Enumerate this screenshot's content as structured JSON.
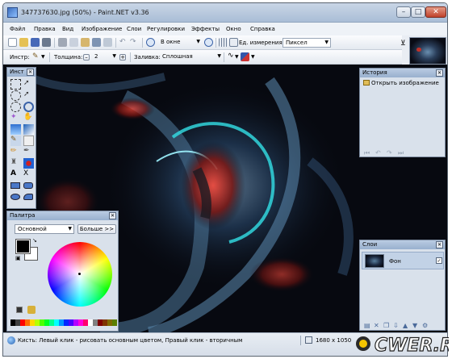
{
  "window": {
    "title": "347737630.jpg (50%) - Paint.NET v3.36"
  },
  "menu": [
    "Файл",
    "Правка",
    "Вид",
    "Изображение",
    "Слои",
    "Регулировки",
    "Эффекты",
    "Окно",
    "Справка"
  ],
  "toolbar1": {
    "zoom_value": "В окне",
    "units_label": "Ед. измерения:",
    "units_value": "Пиксел"
  },
  "toolbar2": {
    "tool_label": "Инстр:",
    "width_label": "Толщина:",
    "width_value": "2",
    "fill_label": "Заливка:",
    "fill_value": "Сплошная"
  },
  "tools_panel": {
    "title": "Инст"
  },
  "palette_panel": {
    "title": "Палитра",
    "palette_select": "Основной",
    "more_button": "Больше >>",
    "colors": [
      "#000000",
      "#404040",
      "#ff0000",
      "#ff6a00",
      "#ffd800",
      "#b6ff00",
      "#4cff00",
      "#00ff21",
      "#00ff90",
      "#00ffff",
      "#0094ff",
      "#0026ff",
      "#4800ff",
      "#b200ff",
      "#ff00dc",
      "#ff006e",
      "#ffffff",
      "#808080",
      "#7f0000",
      "#7f3300",
      "#7f6a00",
      "#5b7f00"
    ]
  },
  "history_panel": {
    "title": "История",
    "item": "Открыть изображение"
  },
  "layers_panel": {
    "title": "Слои",
    "layer_name": "Фон"
  },
  "status": {
    "hint": "Кисть: Левый клик - рисовать основным цветом, Правый клик - вторичным",
    "image_size": "1680 x 1050"
  },
  "watermark": "CWER.RU"
}
